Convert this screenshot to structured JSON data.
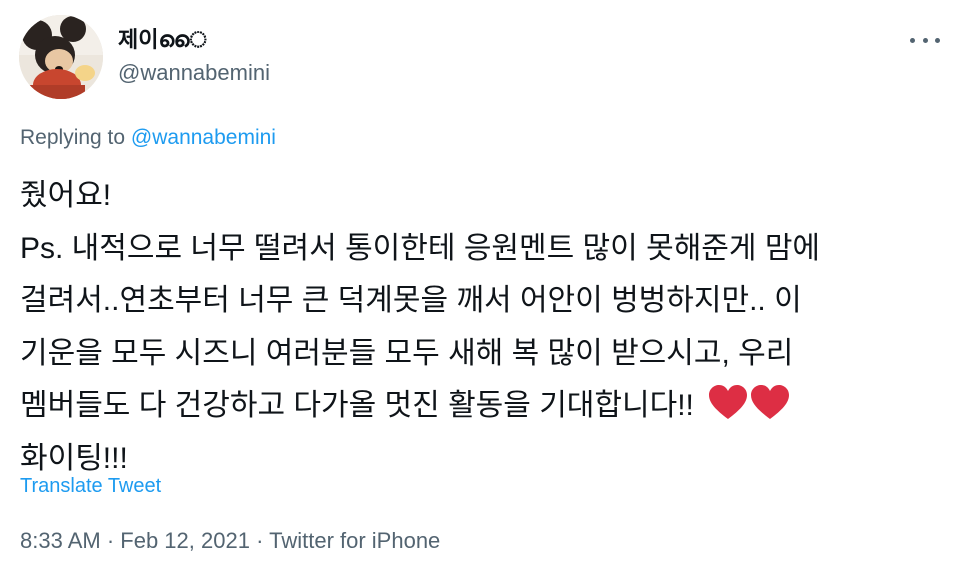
{
  "tweet": {
    "author": {
      "display_name": "제이ൈ",
      "handle": "@wannabemini",
      "avatar_icon": "mickey-plush-avatar"
    },
    "more_icon": "more-horizontal-icon",
    "replying": {
      "prefix": "Replying to ",
      "mention": "@wannabemini"
    },
    "body_lines": [
      "줬어요!",
      "Ps. 내적으로 너무 떨려서 통이한테 응원멘트 많이 못해준게 맘에",
      "걸려서..연초부터 너무 큰 덕계못을 깨서 어안이 벙벙하지만.. 이",
      "기운을 모두 시즈니 여러분들 모두 새해 복 많이 받으시고, 우리",
      "멤버들도 다 건강하고 다가올 멋진 활동을 기대합니다!!",
      "화이팅!!!"
    ],
    "emoji": [
      "red-heart-icon",
      "red-heart-icon"
    ],
    "heart_color": "#dd2e44",
    "translate_label": "Translate Tweet",
    "timestamp": {
      "time": "8:33 AM",
      "separator": " · ",
      "date": "Feb 12, 2021",
      "source": "Twitter for iPhone"
    },
    "colors": {
      "text": "#0f1419",
      "secondary": "#536471",
      "link": "#1d9bf0"
    }
  }
}
